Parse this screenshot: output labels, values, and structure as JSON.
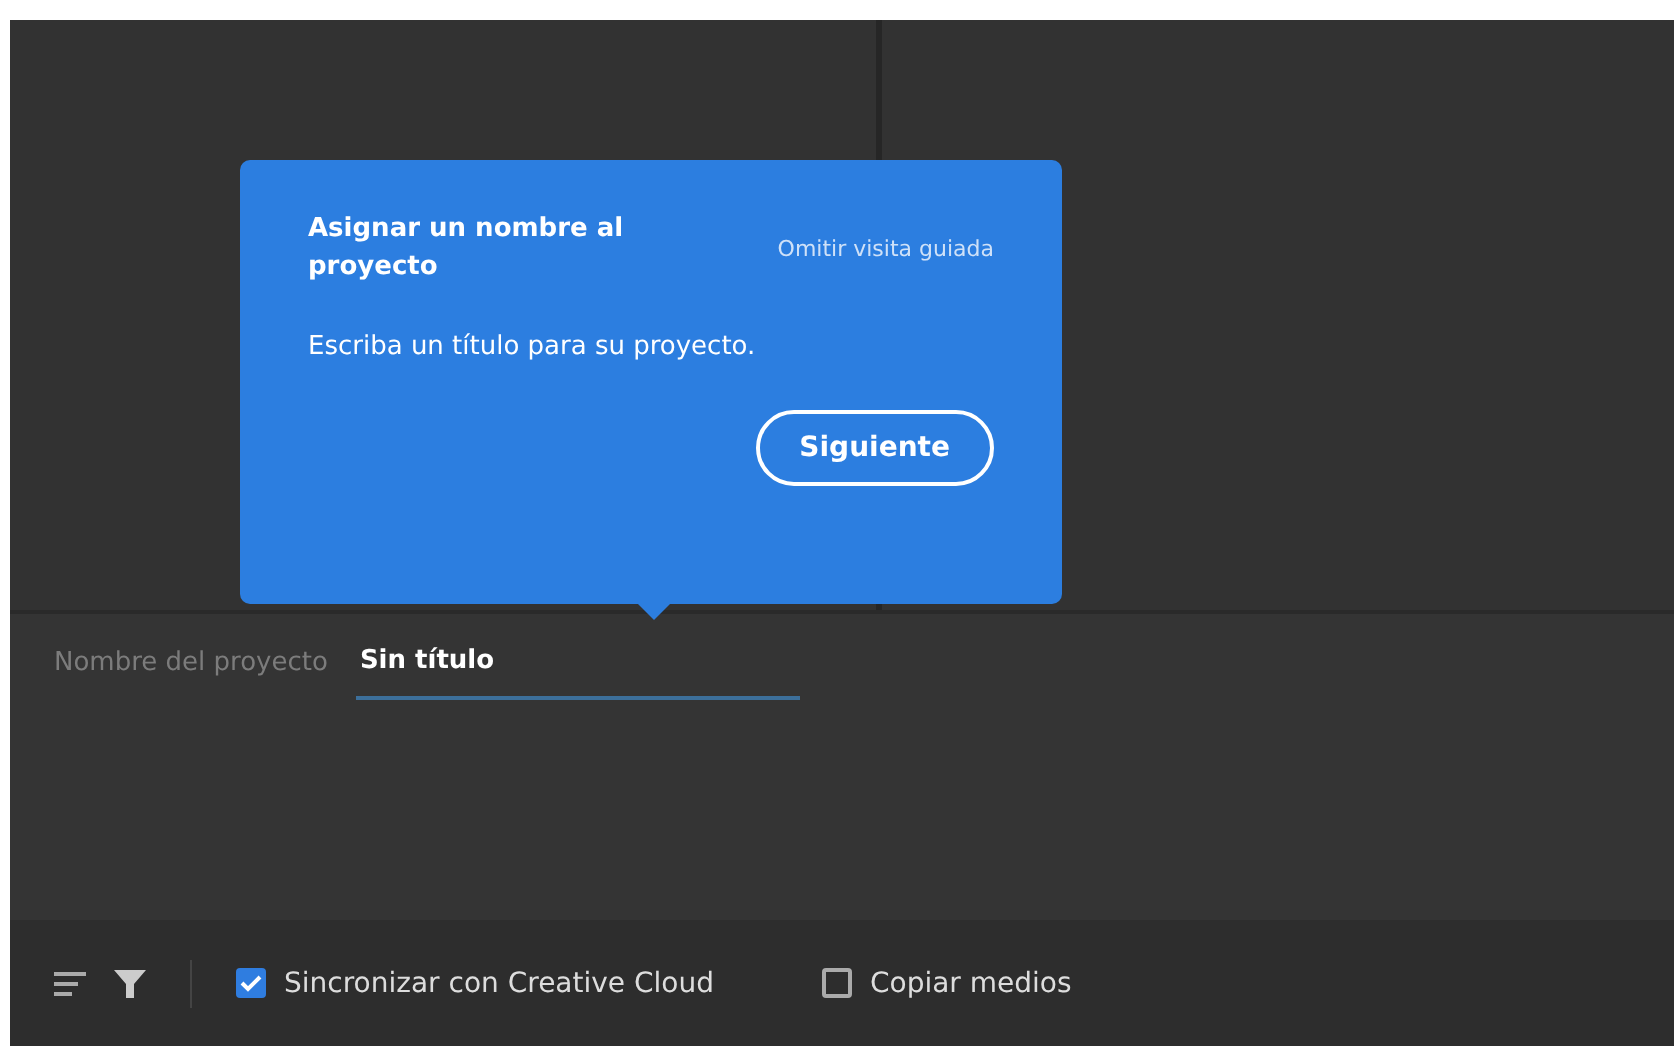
{
  "tour_popover": {
    "title": "Asignar un nombre al proyecto",
    "skip_link": "Omitir visita guiada",
    "message": "Escriba un título para su proyecto.",
    "next_button": "Siguiente"
  },
  "project_name": {
    "label": "Nombre del proyecto",
    "value": "Sin título"
  },
  "bottom_bar": {
    "options": [
      {
        "label": "Sincronizar con Creative Cloud",
        "checked": true
      },
      {
        "label": "Copiar medios",
        "checked": false
      }
    ]
  }
}
